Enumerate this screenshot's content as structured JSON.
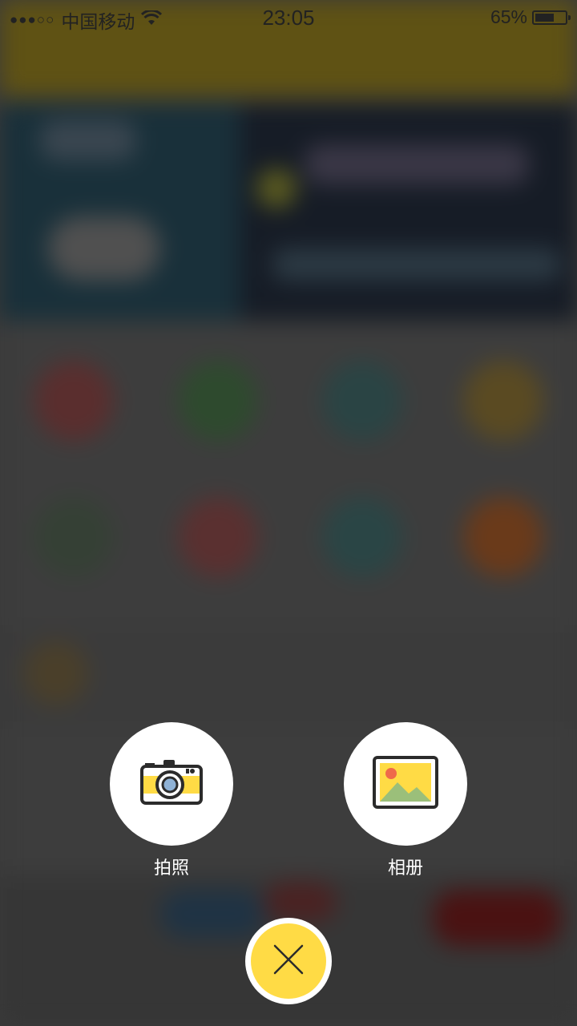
{
  "status_bar": {
    "signal": "●●●○○",
    "carrier": "中国移动",
    "time": "23:05",
    "battery_percent": "65%",
    "battery_level": 0.65
  },
  "actions": [
    {
      "label": "拍照",
      "icon": "camera-icon"
    },
    {
      "label": "相册",
      "icon": "picture-icon"
    }
  ],
  "close_icon": "close-icon",
  "colors": {
    "accent": "#ffdb45",
    "overlay": "#3a3a3a",
    "button_bg": "#ffffff"
  }
}
